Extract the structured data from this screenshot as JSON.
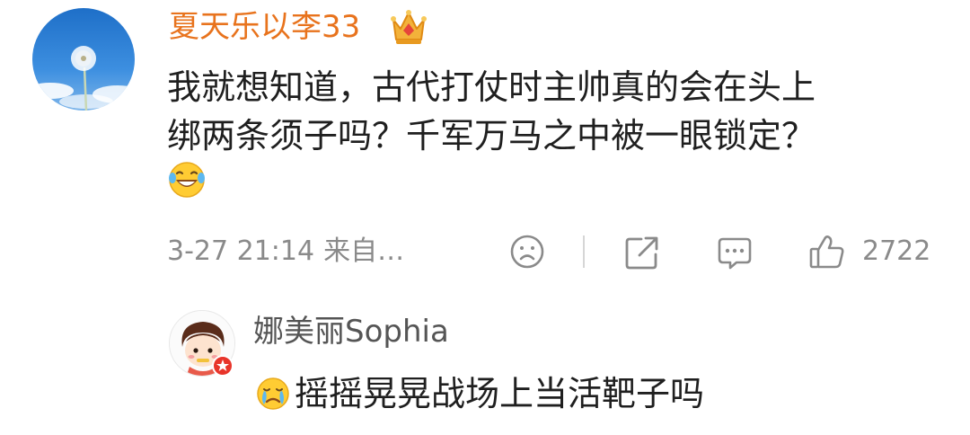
{
  "comment": {
    "username": "夏天乐以李33",
    "username_color": "#e8731d",
    "avatar_icon": "dandelion-sky-photo",
    "badge_icon": "crown-icon",
    "text_lines": [
      "我就想知道，古代打仗时主帅真的会在头上",
      "绑两条须子吗？千军万马之中被一眼锁定？"
    ],
    "emoji_icon": "laughing-tears-emoji",
    "timestamp": "3-27 21:14",
    "source": "来自…",
    "actions": {
      "dislike_icon": "frown-icon",
      "share_icon": "share-icon",
      "reply_icon": "comment-icon",
      "like_icon": "thumbs-up-icon",
      "like_count": "2722"
    }
  },
  "reply": {
    "username": "娜美丽Sophia",
    "avatar_icon": "cartoon-girl-avatar",
    "badge_icon": "vip-badge-icon",
    "emoji_icon": "crying-emoji",
    "text": "摇摇晃晃战场上当活靶子吗"
  },
  "colors": {
    "meta_gray": "#8a8a8a",
    "accent_orange": "#e8731d"
  }
}
